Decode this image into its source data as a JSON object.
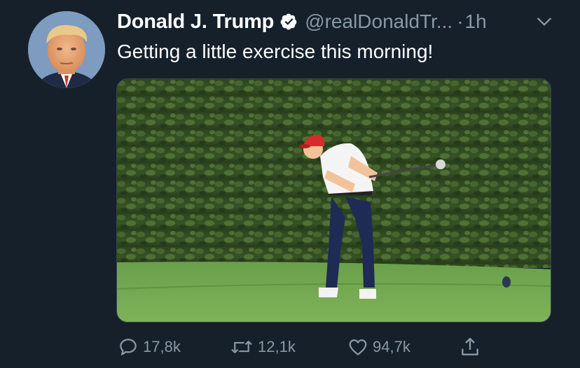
{
  "author": {
    "name": "Donald J. Trump",
    "handle": "@realDonaldTr...",
    "separator": "·",
    "time": "1h"
  },
  "tweet": {
    "text": "Getting a little exercise this morning!"
  },
  "stats": {
    "replies": "17,8k",
    "retweets": "12,1k",
    "likes": "94,7k"
  },
  "icons": {
    "verified": "verified-badge-icon",
    "more": "chevron-down-icon",
    "reply": "reply-icon",
    "retweet": "retweet-icon",
    "like": "heart-icon",
    "share": "share-icon"
  },
  "colors": {
    "background": "#15202b",
    "text": "#ffffff",
    "secondary": "#8899a6",
    "verified": "#ffffff"
  }
}
